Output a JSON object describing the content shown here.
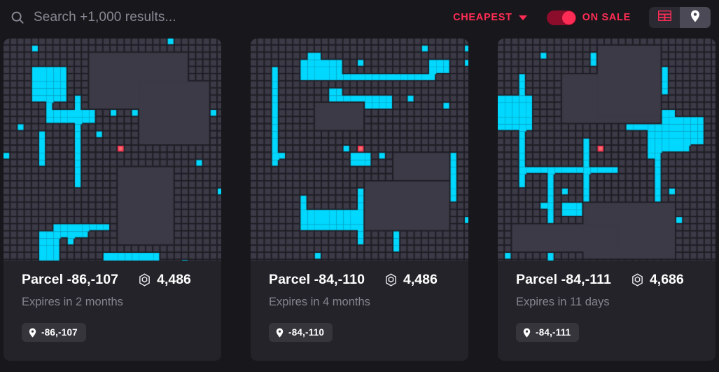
{
  "header": {
    "search": {
      "icon": "search-icon",
      "value": "",
      "placeholder": "Search +1,000 results..."
    },
    "sort": {
      "label": "CHEAPEST",
      "icon": "chevron-down-icon"
    },
    "on_sale": {
      "label": "ON SALE",
      "enabled": true
    },
    "view_toggle": {
      "grid": {
        "icon": "grid-icon",
        "active": false
      },
      "map": {
        "icon": "map-pin-icon",
        "active": true
      }
    }
  },
  "colors": {
    "accent": "#ff2d55",
    "page_background": "#18171b",
    "card_background": "#242329",
    "map_background": "#1e1d24",
    "parcel_tile": "#3b3a46",
    "road": "#00d8ff",
    "highlight_fill": "#f4706e",
    "highlight_border": "#ff2d55",
    "muted_text": "#86838f"
  },
  "cards": [
    {
      "title": "Parcel -86,-107",
      "price": "4,486",
      "price_icon": "mana-icon",
      "expires": "Expires in 2 months",
      "chip": {
        "icon": "map-pin-icon",
        "text": "-86,-107"
      },
      "map_seed": 11
    },
    {
      "title": "Parcel -84,-110",
      "price": "4,486",
      "price_icon": "mana-icon",
      "expires": "Expires in 4 months",
      "chip": {
        "icon": "map-pin-icon",
        "text": "-84,-110"
      },
      "map_seed": 27
    },
    {
      "title": "Parcel -84,-111",
      "price": "4,686",
      "price_icon": "mana-icon",
      "expires": "Expires in 11 days",
      "chip": {
        "icon": "map-pin-icon",
        "text": "-84,-111"
      },
      "map_seed": 43
    }
  ]
}
